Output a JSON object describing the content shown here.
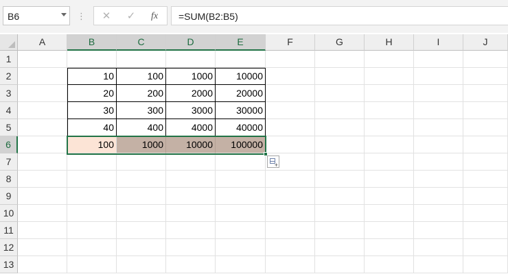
{
  "namebox": {
    "value": "B6"
  },
  "formula_bar": {
    "more_icon": "vertical-ellipsis-icon",
    "cancel_icon": "x-icon",
    "enter_icon": "check-icon",
    "fx_label": "fx",
    "formula": "=SUM(B2:B5)"
  },
  "columns": [
    "A",
    "B",
    "C",
    "D",
    "E",
    "F",
    "G",
    "H",
    "I",
    "J"
  ],
  "rows": [
    "1",
    "2",
    "3",
    "4",
    "5",
    "6",
    "7",
    "8",
    "9",
    "10",
    "11",
    "12",
    "13"
  ],
  "selected_column_headers": [
    "B",
    "C",
    "D",
    "E"
  ],
  "selected_row_header": "6",
  "cells": {
    "B2": "10",
    "C2": "100",
    "D2": "1000",
    "E2": "10000",
    "B3": "20",
    "C3": "200",
    "D3": "2000",
    "E3": "20000",
    "B4": "30",
    "C4": "300",
    "D4": "3000",
    "E4": "30000",
    "B5": "40",
    "C5": "400",
    "D5": "4000",
    "E5": "40000",
    "B6": "100",
    "C6": "1000",
    "D6": "10000",
    "E6": "100000"
  },
  "colors": {
    "accent": "#217346",
    "active_cell_fill": "#fce4d6",
    "selection_fill": "#c4b1a5"
  },
  "quick_analysis": {
    "icon": "quick-analysis-icon"
  }
}
